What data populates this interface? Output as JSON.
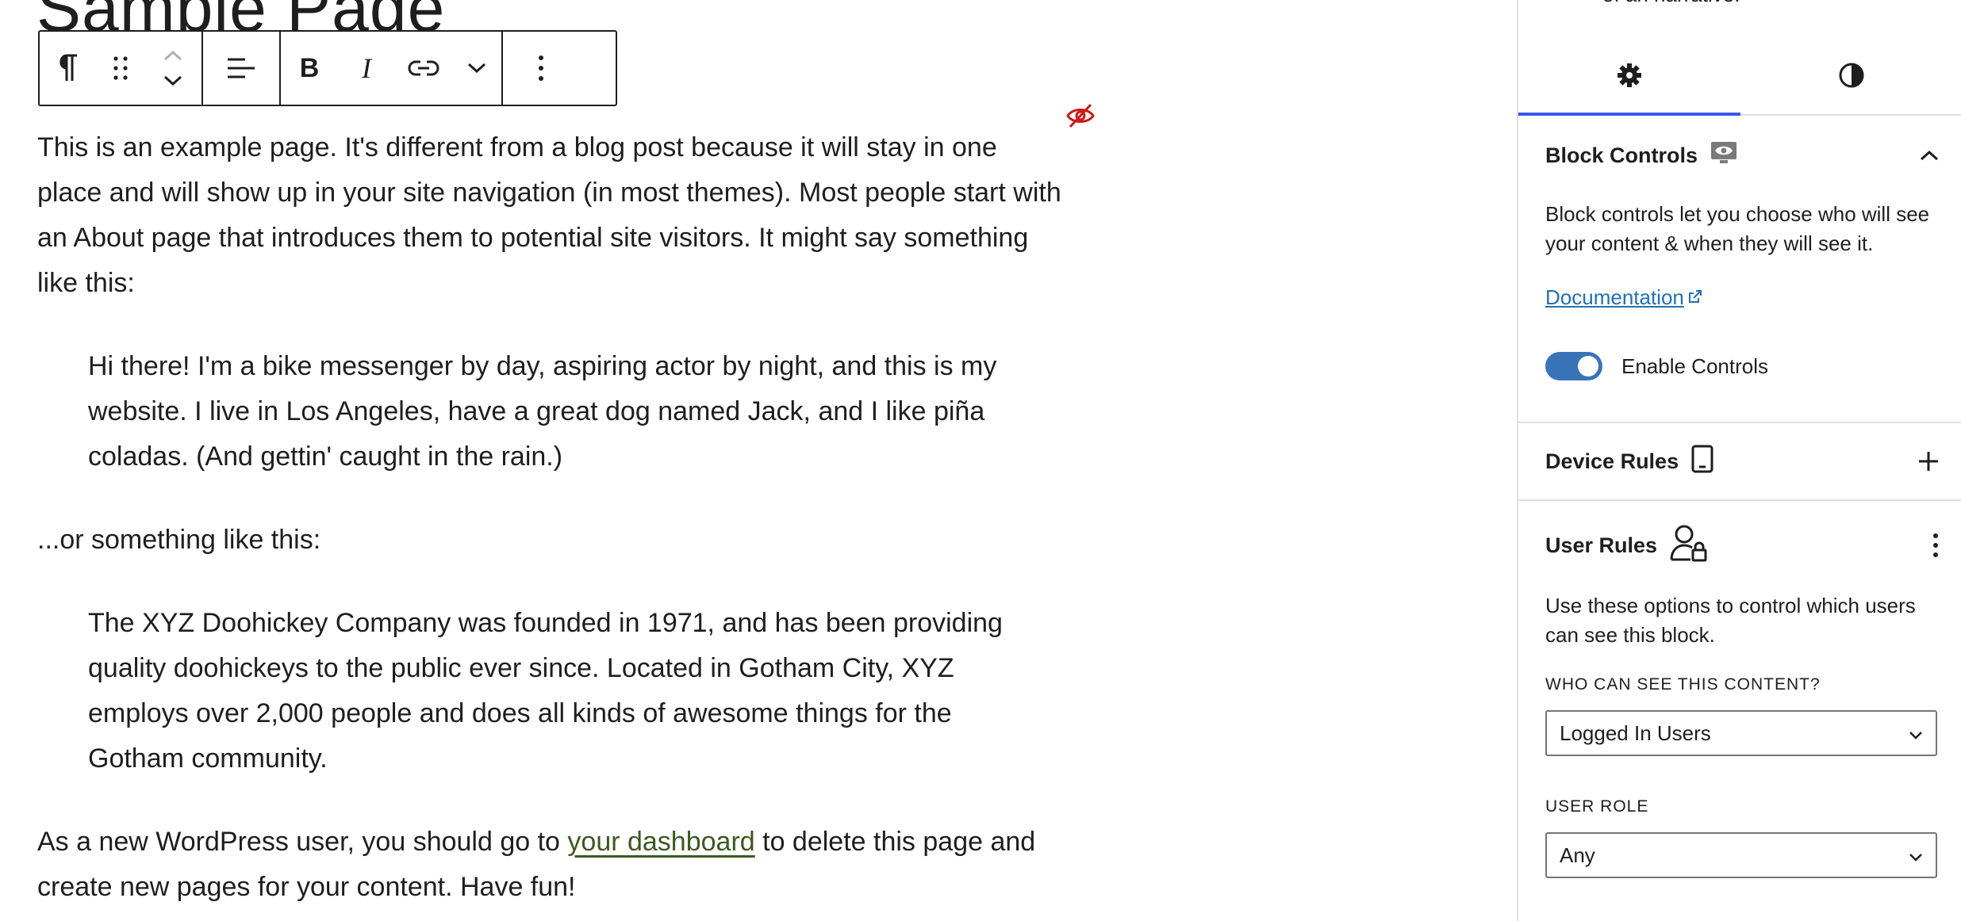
{
  "editor": {
    "page_title": "Sample Page",
    "paragraphs": {
      "p1": "This is an example page. It's different from a blog post because it will stay in one place and will show up in your site navigation (in most themes). Most people start with an About page that introduces them to potential site visitors. It might say something like this:",
      "quote1": "Hi there! I'm a bike messenger by day, aspiring actor by night, and this is my website. I live in Los Angeles, have a great dog named Jack, and I like piña coladas. (And gettin' caught in the rain.)",
      "p2": "...or something like this:",
      "quote2": "The XYZ Doohickey Company was founded in 1971, and has been providing quality doohickeys to the public ever since. Located in Gotham City, XYZ employs over 2,000 people and does all kinds of awesome things for the Gotham community.",
      "p3_before": "As a new WordPress user, you should go to ",
      "p3_link": "your dashboard",
      "p3_after": " to delete this page and create new pages for your content. Have fun!"
    },
    "toolbar": {
      "icons": [
        "pilcrow-icon",
        "drag-handle-icon",
        "move-up-icon",
        "move-down-icon",
        "align-left-icon",
        "bold-icon",
        "italic-icon",
        "link-icon",
        "chevron-down-icon",
        "more-options-icon"
      ]
    },
    "hidden_indicator_color": "#cc1818",
    "link_color": "#3a5a1e"
  },
  "sidebar": {
    "top_cut_text": "of an narrative.",
    "tabs": [
      {
        "icon": "gear-icon",
        "active": true
      },
      {
        "icon": "contrast-icon",
        "active": false
      }
    ],
    "block_controls": {
      "title": "Block Controls",
      "description": "Block controls let you choose who will see your content & when they will see it.",
      "doc_link": "Documentation",
      "toggle_label": "Enable Controls",
      "toggle_on": true
    },
    "device_rules": {
      "title": "Device Rules"
    },
    "user_rules": {
      "title": "User Rules",
      "description": "Use these options to control which users can see this block.",
      "who_label": "WHO CAN SEE THIS CONTENT?",
      "who_value": "Logged In Users",
      "role_label": "USER ROLE",
      "role_value": "Any"
    },
    "accent_color": "#3858e9",
    "toggle_color": "#3a74b8"
  }
}
